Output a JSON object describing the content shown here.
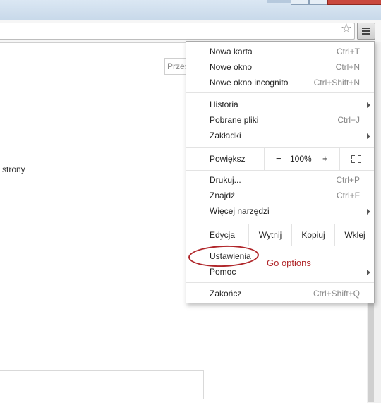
{
  "search": {
    "placeholder_text": "Przeszukaj"
  },
  "page": {
    "text_strony": "strony"
  },
  "menu": {
    "items_top": [
      {
        "label": "Nowa karta",
        "shortcut": "Ctrl+T"
      },
      {
        "label": "Nowe okno",
        "shortcut": "Ctrl+N"
      },
      {
        "label": "Nowe okno incognito",
        "shortcut": "Ctrl+Shift+N"
      }
    ],
    "items_history": [
      {
        "label": "Historia"
      },
      {
        "label": "Pobrane pliki",
        "shortcut": "Ctrl+J"
      },
      {
        "label": "Zakładki"
      }
    ],
    "zoom": {
      "label": "Powiększ",
      "minus": "−",
      "value": "100%",
      "plus": "+"
    },
    "items_tools": [
      {
        "label": "Drukuj...",
        "shortcut": "Ctrl+P"
      },
      {
        "label": "Znajdź",
        "shortcut": "Ctrl+F"
      },
      {
        "label": "Więcej narzędzi"
      }
    ],
    "edit": {
      "label": "Edycja",
      "cut": "Wytnij",
      "copy": "Kopiuj",
      "paste": "Wklej"
    },
    "settings": {
      "label": "Ustawienia"
    },
    "help": {
      "label": "Pomoc"
    },
    "exit": {
      "label": "Zakończ",
      "shortcut": "Ctrl+Shift+Q"
    }
  },
  "annotation": {
    "text": "Go options",
    "color": "#b0262a"
  },
  "icons": {
    "star": "bookmark-star-icon",
    "menu": "hamburger-menu-icon",
    "fullscreen": "fullscreen-icon"
  }
}
